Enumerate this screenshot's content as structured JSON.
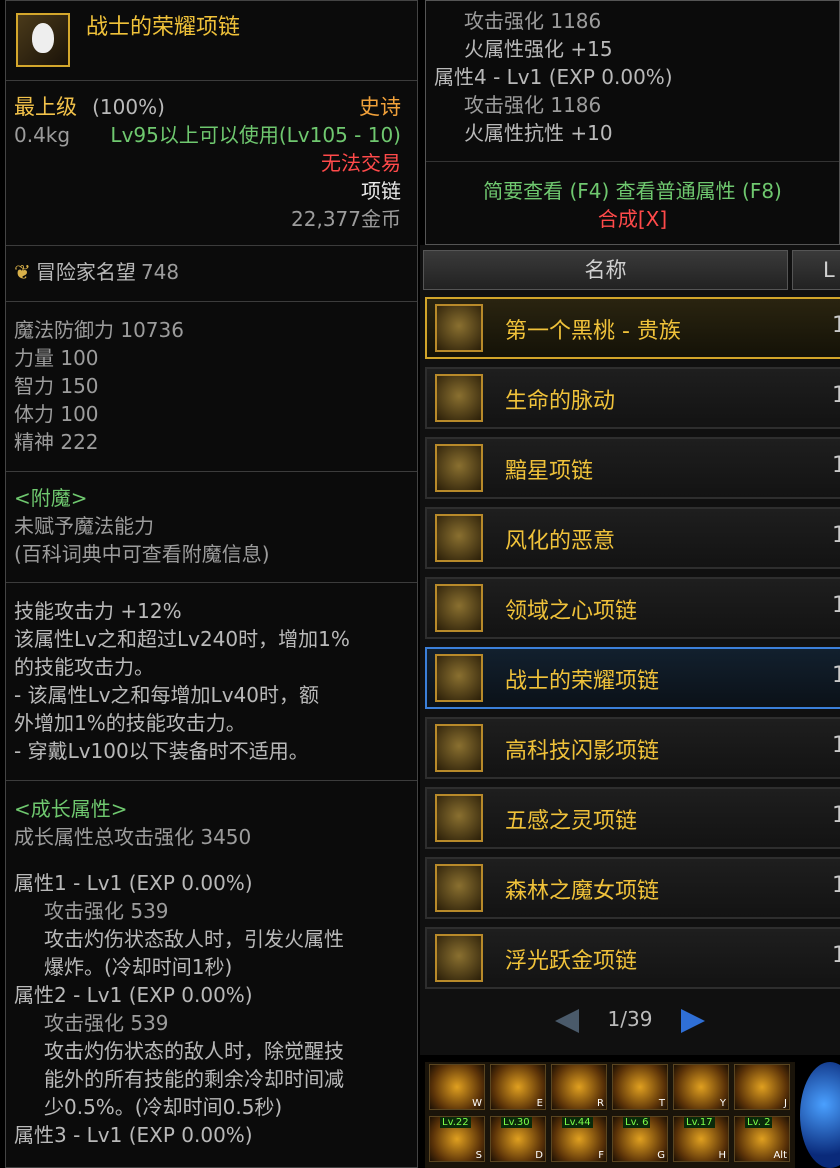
{
  "tooltip": {
    "name": "战士的荣耀项链",
    "grade": "最上级",
    "grade_pct": "(100%)",
    "rarity": "史诗",
    "weight": "0.4kg",
    "level_req": "Lv95以上可以使用(Lv105 - 10)",
    "trade": "无法交易",
    "type": "项链",
    "price": "22,377金币",
    "fame_label": "冒险家名望",
    "fame_value": "748",
    "stats": [
      "魔法防御力 10736",
      "力量 100",
      "智力 150",
      "体力 100",
      "精神 222"
    ],
    "enchant_title": "<附魔>",
    "enchant_lines": [
      "未赋予魔法能力",
      "(百科词典中可查看附魔信息)"
    ],
    "skill_lines": [
      "技能攻击力 +12%",
      "该属性Lv之和超过Lv240时，增加1%",
      "的技能攻击力。",
      "- 该属性Lv之和每增加Lv40时，额",
      "外增加1%的技能攻击力。",
      "- 穿戴Lv100以下装备时不适用。"
    ],
    "growth_title": "<成长属性>",
    "growth_total": "成长属性总攻击强化 3450",
    "attr1_title": "属性1 - Lv1 (EXP 0.00%)",
    "attr1_line1": "攻击强化 539",
    "attr1_line2": "攻击灼伤状态敌人时，引发火属性",
    "attr1_line3": "爆炸。(冷却时间1秒)",
    "attr2_title": "属性2 - Lv1 (EXP 0.00%)",
    "attr2_line1": "攻击强化 539",
    "attr2_line2": "攻击灼伤状态的敌人时，除觉醒技",
    "attr2_line3": "能外的所有技能的剩余冷却时间减",
    "attr2_line4": "少0.5%。(冷却时间0.5秒)",
    "attr3_title": "属性3 - Lv1 (EXP 0.00%)"
  },
  "compare": {
    "line1": "攻击强化 1186",
    "line2": "火属性强化 +15",
    "line3": "属性4 - Lv1 (EXP 0.00%)",
    "line4": "攻击强化 1186",
    "line5": "火属性抗性 +10",
    "links": "简要查看 (F4) 查看普通属性 (F8)",
    "synth": "合成[X]"
  },
  "list": {
    "header_name": "名称",
    "header_lv": "L",
    "items": [
      {
        "name": "第一个黑桃 - 贵族",
        "lv": "1"
      },
      {
        "name": "生命的脉动",
        "lv": "1"
      },
      {
        "name": "黯星项链",
        "lv": "1"
      },
      {
        "name": "风化的恶意",
        "lv": "1"
      },
      {
        "name": "领域之心项链",
        "lv": "1"
      },
      {
        "name": "战士的荣耀项链",
        "lv": "1"
      },
      {
        "name": "高科技闪影项链",
        "lv": "1"
      },
      {
        "name": "五感之灵项链",
        "lv": "1"
      },
      {
        "name": "森林之魔女项链",
        "lv": "1"
      },
      {
        "name": "浮光跃金项链",
        "lv": "1"
      }
    ],
    "page": "1/39"
  },
  "skills": {
    "top_keys": [
      "W",
      "E",
      "R",
      "T",
      "Y",
      "J"
    ],
    "bottom_keys": [
      "S",
      "D",
      "F",
      "G",
      "H",
      "Alt"
    ],
    "bottom_levels": [
      "Lv.22",
      "Lv.30",
      "Lv.44",
      "Lv. 6",
      "Lv.17",
      "Lv. 2"
    ]
  }
}
